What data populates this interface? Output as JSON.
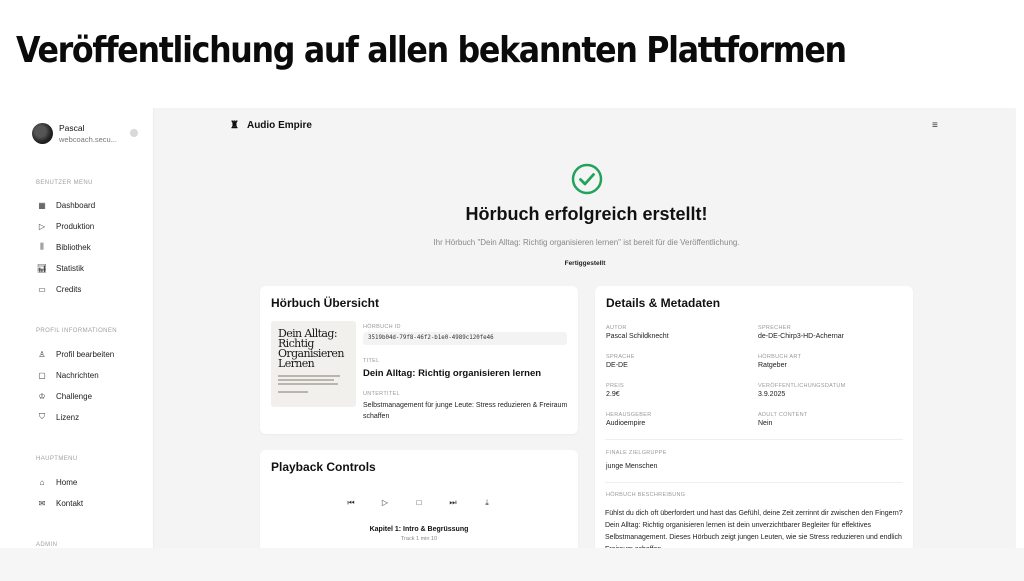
{
  "slide": {
    "title": "Veröffentlichung auf allen bekannten Plattformen"
  },
  "sidebar": {
    "user": {
      "name": "Pascal",
      "email": "webcoach.secu..."
    },
    "sections": [
      {
        "label": "BENUTZER MENU",
        "items": [
          {
            "label": "Dashboard",
            "icon": "grid-icon"
          },
          {
            "label": "Produktion",
            "icon": "play-icon"
          },
          {
            "label": "Bibliothek",
            "icon": "library-icon"
          },
          {
            "label": "Statistik",
            "icon": "chart-icon"
          },
          {
            "label": "Credits",
            "icon": "card-icon"
          }
        ]
      },
      {
        "label": "PROFIL INFORMATIONEN",
        "items": [
          {
            "label": "Profil bearbeiten",
            "icon": "user-icon"
          },
          {
            "label": "Nachrichten",
            "icon": "message-icon"
          },
          {
            "label": "Challenge",
            "icon": "trophy-icon"
          },
          {
            "label": "Lizenz",
            "icon": "shield-icon"
          }
        ]
      },
      {
        "label": "HAUPTMENU",
        "items": [
          {
            "label": "Home",
            "icon": "home-icon"
          },
          {
            "label": "Kontakt",
            "icon": "mail-icon"
          }
        ]
      },
      {
        "label": "ADMIN",
        "items": []
      }
    ]
  },
  "topbar": {
    "title": "Audio Empire"
  },
  "success": {
    "title": "Hörbuch erfolgreich erstellt!",
    "subtitle": "Ihr Hörbuch \"Dein Alltag: Richtig organisieren lernen\" ist bereit für die Veröffentlichung.",
    "status": "Fertiggestellt",
    "accent": "#22a35a"
  },
  "overview": {
    "heading": "Hörbuch Übersicht",
    "cover_title": "Dein Alltag: Richtig Organisieren Lernen",
    "id_label": "HÖRBUCH ID",
    "id_value": "3519b04d-79f8-46f2-b1e0-4989c120fe46",
    "title_label": "TITEL",
    "title_value": "Dein Alltag: Richtig organisieren lernen",
    "subtitle_label": "UNTERTITEL",
    "subtitle_value": "Selbstmanagement für junge Leute: Stress reduzieren & Freiraum schaffen"
  },
  "playback": {
    "heading": "Playback Controls",
    "chapter": "Kapitel 1: Intro & Begrüssung",
    "chapter_sub": "Track 1 min 10",
    "buttons": [
      "skip-back-icon",
      "play-icon",
      "stop-icon",
      "skip-forward-icon",
      "download-icon"
    ]
  },
  "details": {
    "heading": "Details & Metadaten",
    "fields": [
      {
        "label": "AUTOR",
        "value": "Pascal Schildknecht"
      },
      {
        "label": "SPRECHER",
        "value": "de-DE-Chirp3-HD-Achernar"
      },
      {
        "label": "SPRACHE",
        "value": "DE-DE"
      },
      {
        "label": "HÖRBUCH ART",
        "value": "Ratgeber"
      },
      {
        "label": "PREIS",
        "value": "2.9€"
      },
      {
        "label": "VERÖFFENTLICHUNGSDATUM",
        "value": "3.9.2025"
      },
      {
        "label": "HERAUSGEBER",
        "value": "Audioempire"
      },
      {
        "label": "ADULT CONTENT",
        "value": "Nein"
      }
    ],
    "target_label": "FINALE ZIELGRUPPE",
    "target_value": "junge Menschen",
    "desc_label": "HÖRBUCH BESCHREIBUNG",
    "desc_value": "Fühlst du dich oft überfordert und hast das Gefühl, deine Zeit zerrinnt dir zwischen den Fingern? Dein Alltag: Richtig organisieren lernen ist dein unverzichtbarer Begleiter für effektives Selbstmanagement. Dieses Hörbuch zeigt jungen Leuten, wie sie Stress reduzieren und endlich Freiraum schaffen."
  }
}
